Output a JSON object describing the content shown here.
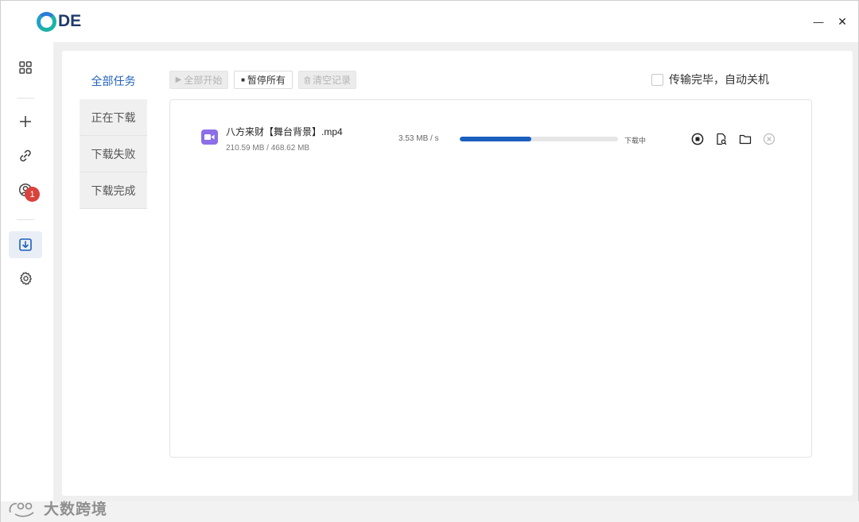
{
  "app": {
    "logo_text": "DE",
    "minimize_symbol": "—",
    "close_symbol": "✕"
  },
  "sidebar": {
    "items": [
      {
        "icon": "grid-icon"
      },
      {
        "icon": "plus-icon"
      },
      {
        "icon": "link-icon"
      },
      {
        "icon": "user-icon"
      },
      {
        "icon": "download-icon",
        "badge": "1",
        "active": true
      },
      {
        "icon": "gear-icon"
      }
    ]
  },
  "tabs": [
    {
      "label": "全部任务",
      "active": true
    },
    {
      "label": "正在下载"
    },
    {
      "label": "下载失败"
    },
    {
      "label": "下载完成"
    }
  ],
  "toolbar": {
    "start_all": "全部开始",
    "pause_all": "暂停所有",
    "clear_records": "清空记录",
    "auto_shutdown_label": "传输完毕，自动关机"
  },
  "downloads": [
    {
      "name": "八方来财【舞台背景】.mp4",
      "size_text": "210.59 MB / 468.62 MB",
      "speed": "3.53 MB / s",
      "progress": 0.45,
      "status": "下载中",
      "icon": "video-file-icon"
    }
  ],
  "watermark": {
    "text": "大数跨境"
  },
  "colors": {
    "accent": "#2463b9",
    "progress": "#1b5fbf",
    "badge": "#d9433c",
    "file_icon": "#8b6ee8"
  }
}
